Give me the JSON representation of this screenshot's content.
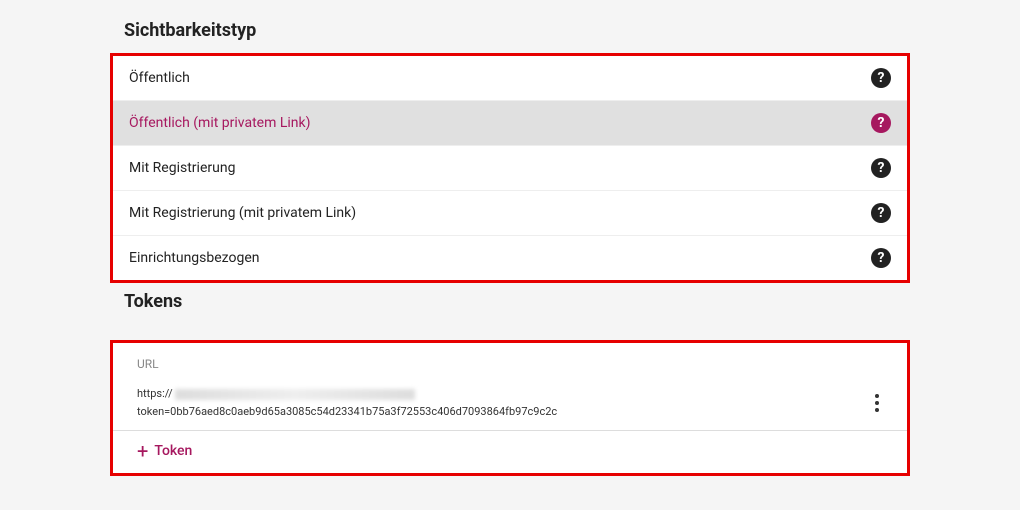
{
  "sections": {
    "visibility": {
      "title": "Sichtbarkeitstyp",
      "options": [
        {
          "label": "Öffentlich",
          "selected": false
        },
        {
          "label": "Öffentlich (mit privatem Link)",
          "selected": true
        },
        {
          "label": "Mit Registrierung",
          "selected": false
        },
        {
          "label": "Mit Registrierung (mit privatem Link)",
          "selected": false
        },
        {
          "label": "Einrichtungsbezogen",
          "selected": false
        }
      ]
    },
    "tokens": {
      "title": "Tokens",
      "header": "URL",
      "rows": [
        {
          "url_prefix": "https://",
          "url_suffix": "token=0bb76aed8c0aeb9d65a3085c54d23341b75a3f72553c406d7093864fb97c9c2c"
        }
      ],
      "add_label": "Token"
    }
  }
}
